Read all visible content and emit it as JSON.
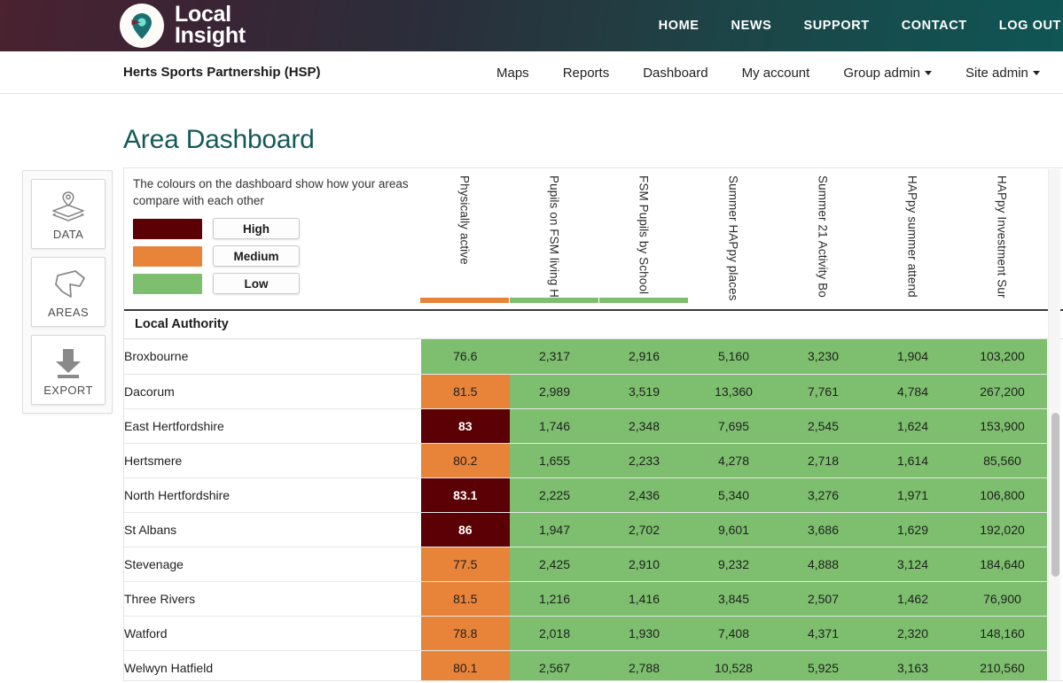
{
  "brand": {
    "name_line1": "Local",
    "name_line2": "Insight",
    "logo_icon": "map-pin-icon"
  },
  "topnav": {
    "items": [
      {
        "label": "HOME"
      },
      {
        "label": "NEWS"
      },
      {
        "label": "SUPPORT"
      },
      {
        "label": "CONTACT"
      },
      {
        "label": "LOG OUT"
      }
    ]
  },
  "subnav": {
    "org": "Herts Sports Partnership (HSP)",
    "items": [
      {
        "label": "Maps",
        "dropdown": false
      },
      {
        "label": "Reports",
        "dropdown": false
      },
      {
        "label": "Dashboard",
        "dropdown": false
      },
      {
        "label": "My account",
        "dropdown": false
      },
      {
        "label": "Group admin",
        "dropdown": true
      },
      {
        "label": "Site admin",
        "dropdown": true
      }
    ]
  },
  "page": {
    "title": "Area Dashboard"
  },
  "rail": {
    "buttons": [
      {
        "label": "DATA",
        "icon": "layers-pin-icon"
      },
      {
        "label": "AREAS",
        "icon": "polygon-area-icon"
      },
      {
        "label": "EXPORT",
        "icon": "download-arrow-icon"
      }
    ]
  },
  "legend": {
    "description": "The colours on the dashboard show how your areas compare with each other",
    "items": [
      {
        "label": "High",
        "color": "#5B0004"
      },
      {
        "label": "Medium",
        "color": "#E8833A"
      },
      {
        "label": "Low",
        "color": "#7DBF6E"
      }
    ]
  },
  "colors": {
    "high": "#5B0004",
    "medium": "#E8833A",
    "low": "#7DBF6E",
    "accent_teal": "#14595C"
  },
  "table": {
    "row_header_label": "Local Authority",
    "columns": [
      {
        "label": "Physically active",
        "bar": "#E8833A"
      },
      {
        "label": "Pupils on FSM living H",
        "bar": "#7DBF6E"
      },
      {
        "label": "FSM Pupils by School",
        "bar": "#7DBF6E"
      },
      {
        "label": "Summer HAPpy places",
        "bar": ""
      },
      {
        "label": "Summer 21 Activity Bo",
        "bar": ""
      },
      {
        "label": "HAPpy summer attend",
        "bar": ""
      },
      {
        "label": "HAPpy Investment Sur",
        "bar": ""
      }
    ],
    "rows": [
      {
        "name": "Broxbourne",
        "cells": [
          {
            "v": "76.6",
            "band": "low"
          },
          {
            "v": "2,317",
            "band": "low"
          },
          {
            "v": "2,916",
            "band": "low"
          },
          {
            "v": "5,160",
            "band": "low"
          },
          {
            "v": "3,230",
            "band": "low"
          },
          {
            "v": "1,904",
            "band": "low"
          },
          {
            "v": "103,200",
            "band": "low"
          }
        ]
      },
      {
        "name": "Dacorum",
        "cells": [
          {
            "v": "81.5",
            "band": "medium"
          },
          {
            "v": "2,989",
            "band": "low"
          },
          {
            "v": "3,519",
            "band": "low"
          },
          {
            "v": "13,360",
            "band": "low"
          },
          {
            "v": "7,761",
            "band": "low"
          },
          {
            "v": "4,784",
            "band": "low"
          },
          {
            "v": "267,200",
            "band": "low"
          }
        ]
      },
      {
        "name": "East Hertfordshire",
        "cells": [
          {
            "v": "83",
            "band": "high"
          },
          {
            "v": "1,746",
            "band": "low"
          },
          {
            "v": "2,348",
            "band": "low"
          },
          {
            "v": "7,695",
            "band": "low"
          },
          {
            "v": "2,545",
            "band": "low"
          },
          {
            "v": "1,624",
            "band": "low"
          },
          {
            "v": "153,900",
            "band": "low"
          }
        ]
      },
      {
        "name": "Hertsmere",
        "cells": [
          {
            "v": "80.2",
            "band": "medium"
          },
          {
            "v": "1,655",
            "band": "low"
          },
          {
            "v": "2,233",
            "band": "low"
          },
          {
            "v": "4,278",
            "band": "low"
          },
          {
            "v": "2,718",
            "band": "low"
          },
          {
            "v": "1,614",
            "band": "low"
          },
          {
            "v": "85,560",
            "band": "low"
          }
        ]
      },
      {
        "name": "North Hertfordshire",
        "cells": [
          {
            "v": "83.1",
            "band": "high"
          },
          {
            "v": "2,225",
            "band": "low"
          },
          {
            "v": "2,436",
            "band": "low"
          },
          {
            "v": "5,340",
            "band": "low"
          },
          {
            "v": "3,276",
            "band": "low"
          },
          {
            "v": "1,971",
            "band": "low"
          },
          {
            "v": "106,800",
            "band": "low"
          }
        ]
      },
      {
        "name": "St Albans",
        "cells": [
          {
            "v": "86",
            "band": "high"
          },
          {
            "v": "1,947",
            "band": "low"
          },
          {
            "v": "2,702",
            "band": "low"
          },
          {
            "v": "9,601",
            "band": "low"
          },
          {
            "v": "3,686",
            "band": "low"
          },
          {
            "v": "1,629",
            "band": "low"
          },
          {
            "v": "192,020",
            "band": "low"
          }
        ]
      },
      {
        "name": "Stevenage",
        "cells": [
          {
            "v": "77.5",
            "band": "medium"
          },
          {
            "v": "2,425",
            "band": "low"
          },
          {
            "v": "2,910",
            "band": "low"
          },
          {
            "v": "9,232",
            "band": "low"
          },
          {
            "v": "4,888",
            "band": "low"
          },
          {
            "v": "3,124",
            "band": "low"
          },
          {
            "v": "184,640",
            "band": "low"
          }
        ]
      },
      {
        "name": "Three Rivers",
        "cells": [
          {
            "v": "81.5",
            "band": "medium"
          },
          {
            "v": "1,216",
            "band": "low"
          },
          {
            "v": "1,416",
            "band": "low"
          },
          {
            "v": "3,845",
            "band": "low"
          },
          {
            "v": "2,507",
            "band": "low"
          },
          {
            "v": "1,462",
            "band": "low"
          },
          {
            "v": "76,900",
            "band": "low"
          }
        ]
      },
      {
        "name": "Watford",
        "cells": [
          {
            "v": "78.8",
            "band": "medium"
          },
          {
            "v": "2,018",
            "band": "low"
          },
          {
            "v": "1,930",
            "band": "low"
          },
          {
            "v": "7,408",
            "band": "low"
          },
          {
            "v": "4,371",
            "band": "low"
          },
          {
            "v": "2,320",
            "band": "low"
          },
          {
            "v": "148,160",
            "band": "low"
          }
        ]
      },
      {
        "name": "Welwyn Hatfield",
        "cells": [
          {
            "v": "80.1",
            "band": "medium"
          },
          {
            "v": "2,567",
            "band": "low"
          },
          {
            "v": "2,788",
            "band": "low"
          },
          {
            "v": "10,528",
            "band": "low"
          },
          {
            "v": "5,925",
            "band": "low"
          },
          {
            "v": "3,163",
            "band": "low"
          },
          {
            "v": "210,560",
            "band": "low"
          }
        ]
      }
    ]
  }
}
